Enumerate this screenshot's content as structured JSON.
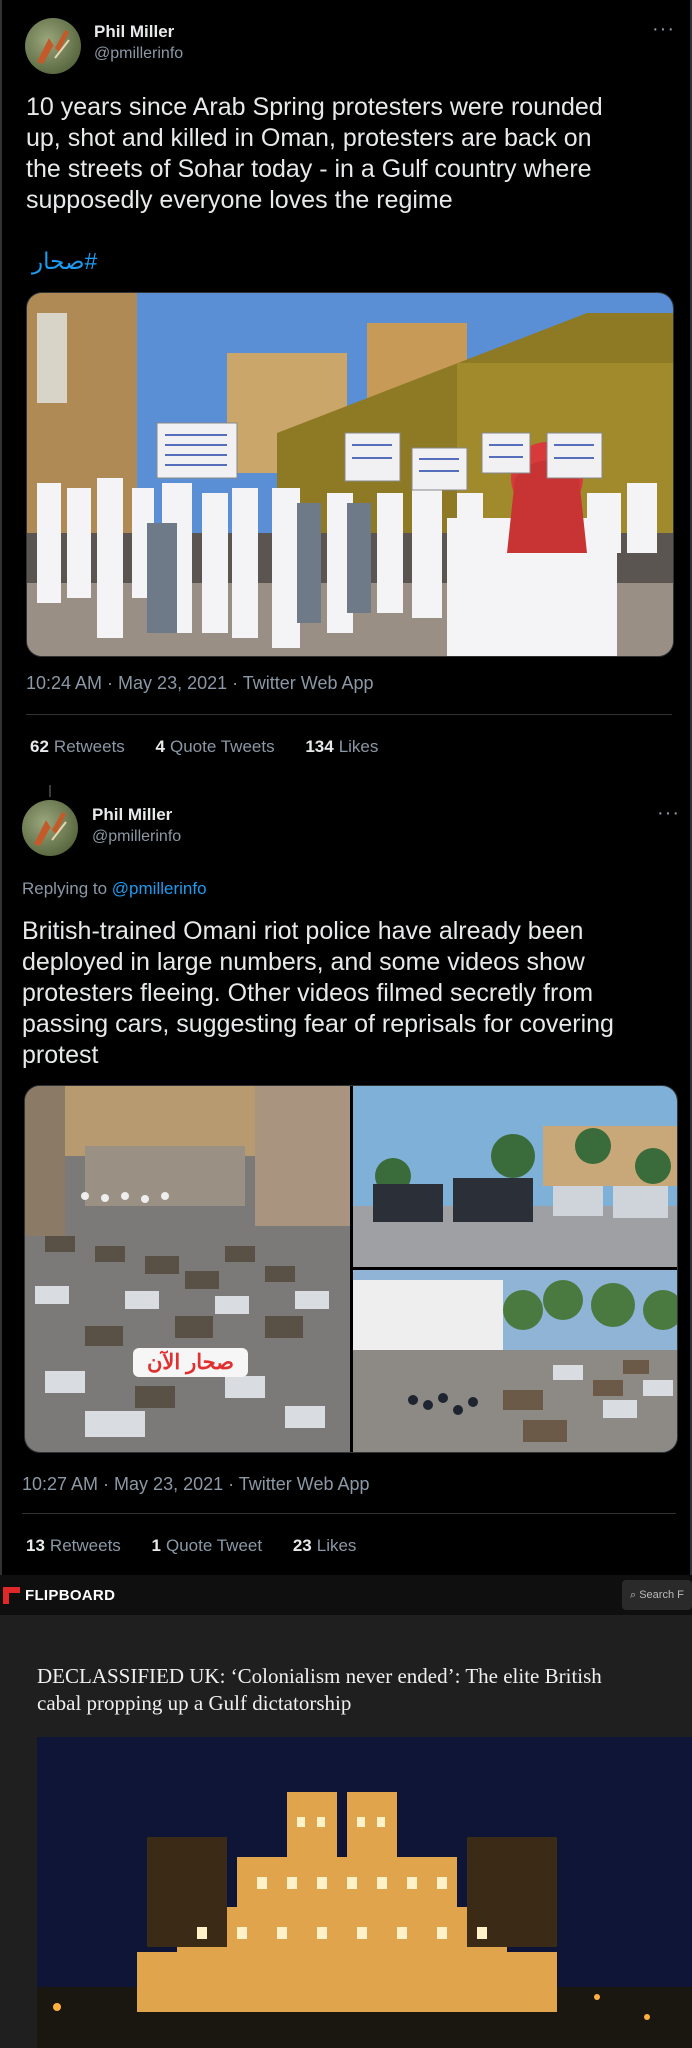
{
  "tweet1": {
    "author_name": "Phil Miller",
    "author_handle": "@pmillerinfo",
    "more_icon": "more-icon",
    "text_lines": [
      "10 years since Arab Spring protesters were rounded",
      "up, shot and killed in Oman, protesters are back on",
      "the streets of Sohar today - in a Gulf country where",
      "supposedly everyone loves the regime"
    ],
    "hashtag": "#صحار",
    "timestamp": "10:24 AM · May 23, 2021 · Twitter Web App",
    "stats": {
      "retweets_count": "62",
      "retweets_label": "Retweets",
      "quotes_count": "4",
      "quotes_label": "Quote Tweets",
      "likes_count": "134",
      "likes_label": "Likes"
    }
  },
  "tweet2": {
    "author_name": "Phil Miller",
    "author_handle": "@pmillerinfo",
    "replying_prefix": "Replying to",
    "replying_to": "@pmillerinfo",
    "text_lines": [
      "British-trained Omani riot police have already been",
      "deployed in large numbers, and some videos show",
      "protesters fleeing. Other videos filmed secretly from",
      "passing cars, suggesting fear of reprisals for covering",
      "protest"
    ],
    "photo_caption": "صحار الآن",
    "timestamp": "10:27 AM · May 23, 2021 · Twitter Web App",
    "stats": {
      "retweets_count": "13",
      "retweets_label": "Retweets",
      "quotes_count": "1",
      "quotes_label": "Quote Tweet",
      "likes_count": "23",
      "likes_label": "Likes"
    }
  },
  "flipboard": {
    "brand": "FLIPBOARD",
    "search_placeholder": "Search F",
    "headline_line1": "DECLASSIFIED UK: ‘Colonialism never ended’: The elite British",
    "headline_line2": "cabal propping up a Gulf dictatorship"
  },
  "colors": {
    "link": "#1d9bf0",
    "background": "#000000",
    "flipboard_red": "#e12828"
  }
}
